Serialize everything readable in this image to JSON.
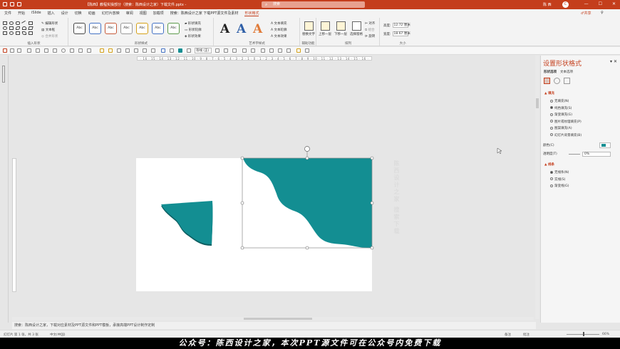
{
  "window": {
    "title": "【陈西】教程实操部分（搜索：陈西设计之家）下载文件.pptx  -",
    "search_placeholder": "搜索",
    "user_name": "陈 西",
    "avatar_letter": "C",
    "minimize": "—",
    "restore": "☐",
    "close": "✕"
  },
  "menu": {
    "tabs": [
      "文件",
      "开始",
      "iSlide",
      "插入",
      "设计",
      "切换",
      "动画",
      "幻灯片放映",
      "审阅",
      "视图",
      "加载项",
      "搜索：陈西设计之家 下载PPT源文件及素材",
      "形状格式"
    ],
    "active_tab": "形状格式",
    "share_label": "♂共享",
    "comment_label": "♀"
  },
  "ribbon": {
    "insert_shapes": {
      "edit_shape": "编辑形状",
      "text_box": "文本框",
      "merge_shapes": "合并形状",
      "label": "插入形状"
    },
    "shape_styles": {
      "preset_label": "Abc",
      "fill": "形状填充",
      "outline": "形状轮廓",
      "effects": "形状效果",
      "label": "形状样式"
    },
    "wordart": {
      "text_fill": "文本填充",
      "text_outline": "文本轮廓",
      "text_effects": "文本效果",
      "label": "艺术字样式"
    },
    "accessibility": {
      "alt_text": "替换文字",
      "label": "辅助功能"
    },
    "arrange": {
      "bring_forward": "上移一层",
      "send_backward": "下移一层",
      "selection_pane": "选择窗格",
      "align": "对齐",
      "group": "组合",
      "rotate": "旋转",
      "label": "排列"
    },
    "size": {
      "height_label": "高度:",
      "height_value": "12.72 厘米",
      "width_label": "宽度:",
      "width_value": "18.67 厘米",
      "label": "大小"
    }
  },
  "toolbar": {
    "font_size": "等线 (正)"
  },
  "ruler": {
    "marks": "· 16 · 15 · 14 · 13 · 12 · 11 · 10 · 9 · 8 · 7 · 6 · 5 · 4 · 3 · 2 · 1 · 0 · 1 · 2 · 3 · 4 · 5 · 6 · 7 · 8 · 9 · 10 · 11 · 12 · 13 · 14 · 15 · 16 ·"
  },
  "colors": {
    "accent": "#c43e1c",
    "shape_fill": "#138e92",
    "shape_shadow": "#0c5d60"
  },
  "slide_side_text": "陈西设计之家 搜索下载",
  "format_pane": {
    "title": "设置形状格式",
    "close": "▾ ✕",
    "tabs": [
      "形状选项",
      "文本选项"
    ],
    "fill_section": "▲ 填充",
    "fill_options": [
      "无填充(N)",
      "纯色填充(S)",
      "渐变填充(G)",
      "图片或纹理填充(P)",
      "图案填充(A)",
      "幻灯片背景填充(B)"
    ],
    "fill_selected": 1,
    "color_label": "颜色(C)",
    "transparency_label": "透明度(T)",
    "transparency_value": "0%",
    "line_section": "▲ 线条",
    "line_options": [
      "无线条(N)",
      "实线(S)",
      "渐变线(G)"
    ],
    "line_selected": 0
  },
  "notes": {
    "text": "搜索：陈西设计之家，下载对应素材及PPT源文件和PPT模板，承接高端PPT设计制作定制"
  },
  "status": {
    "slide_info": "幻灯片 第 1 张，共 3 张",
    "language": "中文(中国)",
    "notes_label": "备注",
    "comments_label": "批注",
    "zoom": "66%"
  },
  "caption": {
    "text": "公众号：陈西设计之家，本次PPT源文件可在公众号内免费下载"
  }
}
